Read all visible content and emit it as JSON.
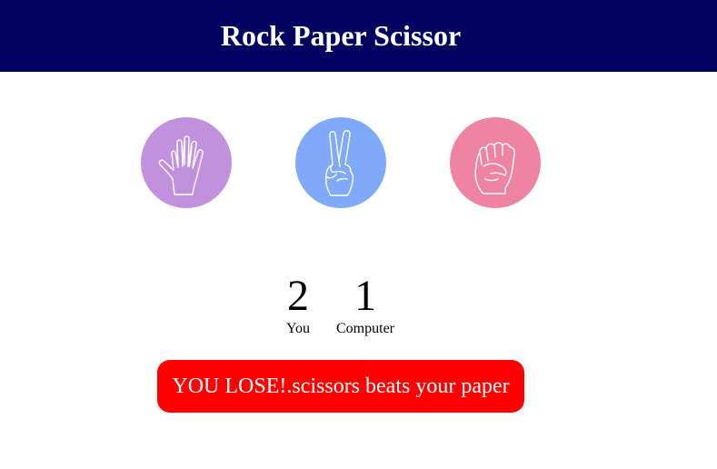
{
  "header": {
    "title": "Rock Paper Scissor",
    "background": "#01015f"
  },
  "choices": [
    {
      "name": "paper",
      "icon": "open-hand-icon",
      "color": "#c191dd"
    },
    {
      "name": "scissors",
      "icon": "peace-hand-icon",
      "color": "#7eaaf9"
    },
    {
      "name": "rock",
      "icon": "fist-icon",
      "color": "#ee84a1"
    }
  ],
  "score": {
    "you_value": "2",
    "you_label": "You",
    "computer_value": "1",
    "computer_label": "Computer"
  },
  "result": {
    "message": "YOU LOSE!.scissors beats your paper",
    "color": "#ff0000"
  }
}
